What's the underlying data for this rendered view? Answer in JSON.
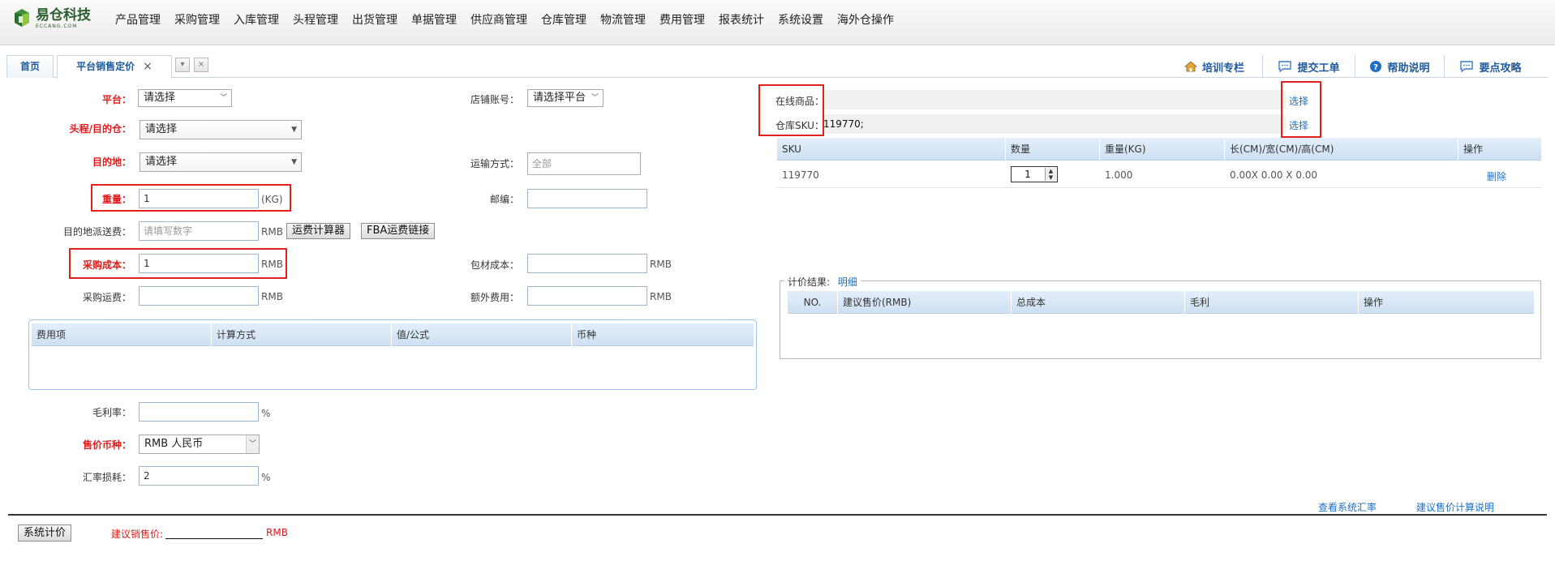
{
  "app": {
    "logo_cn": "易仓科技",
    "logo_en": "ECCANG.COM",
    "menu": [
      "产品管理",
      "采购管理",
      "入库管理",
      "头程管理",
      "出货管理",
      "单据管理",
      "供应商管理",
      "仓库管理",
      "物流管理",
      "费用管理",
      "报表统计",
      "系统设置",
      "海外仓操作"
    ]
  },
  "tabs": {
    "home": "首页",
    "active": "平台销售定价",
    "close": "×",
    "ctrl_down": "▾",
    "ctrl_close": "×"
  },
  "right_links": {
    "training": "培训专栏",
    "ticket": "提交工单",
    "help": "帮助说明",
    "tips": "要点攻略"
  },
  "form": {
    "platform_label": "平台：",
    "platform_value": "请选择",
    "store_label": "店铺账号：",
    "store_value": "请选择平台",
    "dest_wh_label": "头程/目的仓：",
    "dest_wh_value": "请选择",
    "destination_label": "目的地：",
    "destination_value": "请选择",
    "shipping_method_label": "运输方式：",
    "shipping_method_placeholder": "全部",
    "weight_label": "重量：",
    "weight_value": "1",
    "weight_unit": "(KG)",
    "postcode_label": "邮编：",
    "postcode_value": "",
    "delivery_fee_label": "目的地派送费：",
    "delivery_fee_placeholder": "请填写数字",
    "delivery_fee_unit": "RMB",
    "freight_calc_button": "运费计算器",
    "fba_link_button": "FBA运费链接",
    "purchase_cost_label": "采购成本：",
    "purchase_cost_value": "1",
    "purchase_cost_unit": "RMB",
    "packing_cost_label": "包材成本：",
    "packing_cost_value": "",
    "packing_cost_unit": "RMB",
    "purchase_freight_label": "采购运费：",
    "purchase_freight_value": "",
    "purchase_freight_unit": "RMB",
    "extra_fee_label": "额外费用：",
    "extra_fee_value": "",
    "extra_fee_unit": "RMB",
    "margin_label": "毛利率：",
    "margin_value": "",
    "margin_unit": "%",
    "currency_label": "售价币种：",
    "currency_value": "RMB 人民币",
    "fx_loss_label": "汇率损耗：",
    "fx_loss_value": "2",
    "fx_loss_unit": "%"
  },
  "fee_table": {
    "headers": [
      "费用项",
      "计算方式",
      "值/公式",
      "币种"
    ]
  },
  "product": {
    "online_label": "在线商品：",
    "online_value": "",
    "sku_label": "仓库SKU：",
    "sku_value": "119770;",
    "select_online": "选择",
    "select_sku": "选择"
  },
  "sku_table": {
    "headers": [
      "SKU",
      "数量",
      "重量(KG)",
      "长(CM)/宽(CM)/高(CM)",
      "操作"
    ],
    "rows": [
      {
        "sku": "119770",
        "qty": "1",
        "weight": "1.000",
        "dims": "0.00X 0.00 X 0.00",
        "action": "删除"
      }
    ]
  },
  "result": {
    "legend": "计价结果:",
    "detail_link": "明细",
    "headers": [
      "NO.",
      "建议售价(RMB)",
      "总成本",
      "毛利",
      "操作"
    ]
  },
  "footer": {
    "view_rates": "查看系统汇率",
    "price_explain": "建议售价计算说明",
    "calc_button": "系统计价",
    "suggest_label": "建议销售价:",
    "suggest_value": "",
    "suggest_unit": "RMB"
  }
}
